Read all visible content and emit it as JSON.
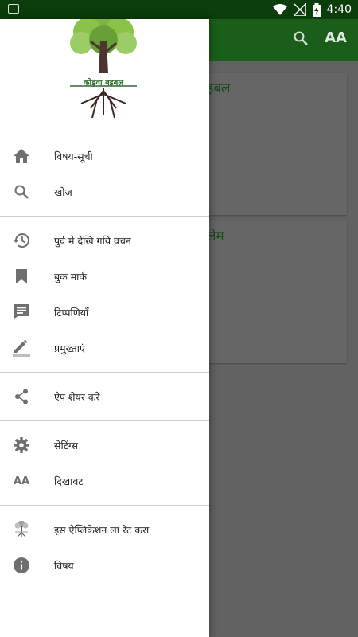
{
  "status_bar": {
    "time": "4:40",
    "icons": [
      "image-icon",
      "wifi-icon",
      "no-signal-icon",
      "battery-charging-icon"
    ]
  },
  "app_bar": {
    "icons": [
      "search-icon",
      "font-size-icon"
    ],
    "font_icon_text": "AA",
    "color": "#1a5e1a"
  },
  "background_cards": [
    {
      "title_fragment": "इबल"
    },
    {
      "title_fragment": "लेम"
    }
  ],
  "drawer": {
    "logo_text": "कोड़वा बइबल",
    "groups": [
      [
        {
          "label": "विषय-सूची",
          "icon": "home-icon"
        },
        {
          "label": "खोज",
          "icon": "search-icon"
        }
      ],
      [
        {
          "label": "पुर्व मे देखि गयि वचन",
          "icon": "history-icon"
        },
        {
          "label": "बुक मार्क",
          "icon": "bookmark-icon"
        },
        {
          "label": "टिप्पणियाँ",
          "icon": "comment-icon"
        },
        {
          "label": "प्रमुख्ताएं",
          "icon": "highlight-pen-icon"
        }
      ],
      [
        {
          "label": "ऐप शेयर करें",
          "icon": "share-icon"
        }
      ],
      [
        {
          "label": "सेटिंग्स",
          "icon": "settings-gear-icon"
        },
        {
          "label": "दिखावट",
          "icon": "text-appearance-icon"
        }
      ],
      [
        {
          "label": "इस ऐप्लिकेशन ला रेट करा",
          "icon": "tree-logo-icon"
        },
        {
          "label": "विषय",
          "icon": "info-icon"
        }
      ]
    ],
    "icon_text_appearance": "AA"
  },
  "colors": {
    "primary": "#1a5e1a",
    "status_bar": "#0a3d0a",
    "drawer_bg": "#ffffff",
    "icon_grey": "#757575"
  }
}
